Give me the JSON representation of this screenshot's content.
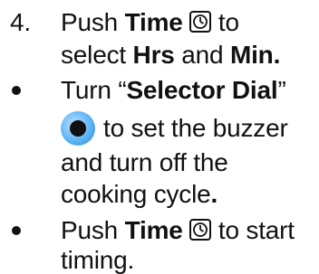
{
  "step4": {
    "number": "4.",
    "push": "Push",
    "time": "Time",
    "to": "to",
    "select": "select",
    "hrs": "Hrs",
    "and": "and",
    "min": "Min",
    "period": "."
  },
  "bullet1": {
    "turn": "Turn “",
    "selector_dial": "Selector Dial",
    "close_quote": "”",
    "line2": "to set the buzzer",
    "line3": "and turn off the",
    "line4_text": "cooking cycle",
    "line4_period": "."
  },
  "bullet2": {
    "push": "Push",
    "time": "Time",
    "line1_end": "to start",
    "line2": "timing."
  },
  "icons": {
    "time_button": "clock-icon",
    "selector_dial": "dial-knob-icon",
    "dial_color": "#4aa8f0"
  }
}
